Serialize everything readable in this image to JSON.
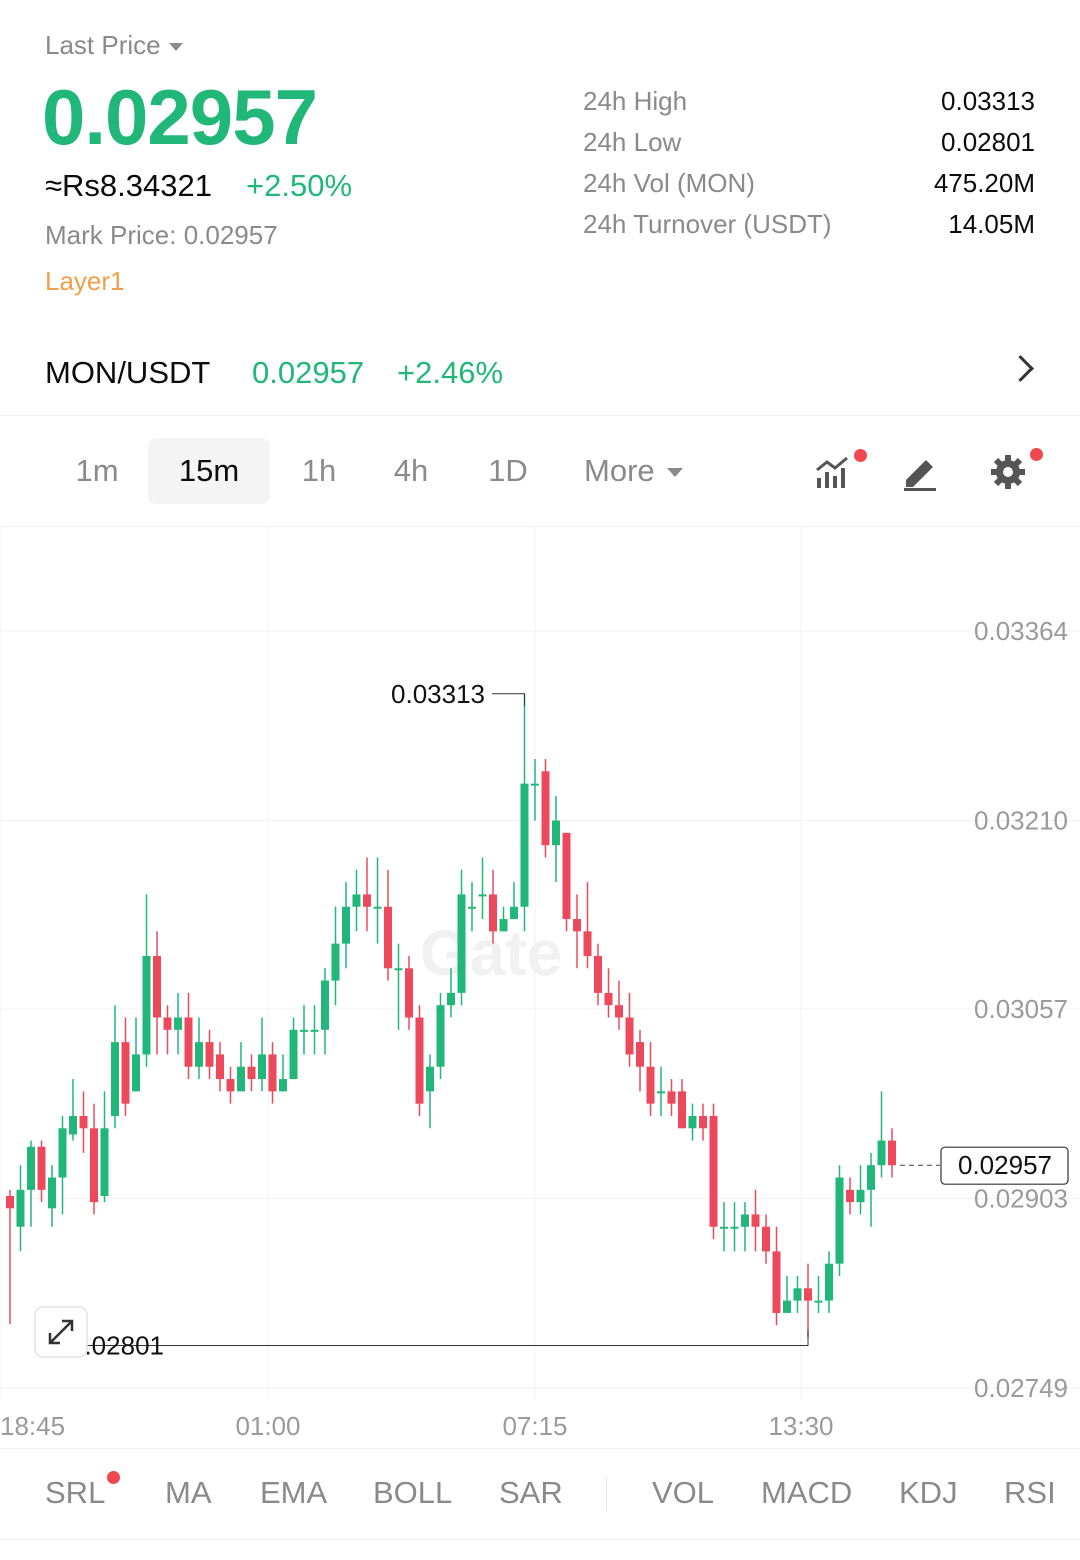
{
  "header": {
    "last_price_label": "Last Price",
    "last_price": "0.02957",
    "fiat_price": "≈Rs8.34321",
    "change_pct": "+2.50%",
    "mark_price_label": "Mark Price:",
    "mark_price": "0.02957",
    "tag": "Layer1"
  },
  "stats": [
    {
      "label": "24h High",
      "value": "0.03313"
    },
    {
      "label": "24h Low",
      "value": "0.02801"
    },
    {
      "label": "24h Vol (MON)",
      "value": "475.20M"
    },
    {
      "label": "24h Turnover (USDT)",
      "value": "14.05M"
    }
  ],
  "pair": {
    "name": "MON/USDT",
    "price": "0.02957",
    "change": "+2.46%"
  },
  "intervals": {
    "items": [
      "1m",
      "15m",
      "1h",
      "4h",
      "1D"
    ],
    "active": "15m",
    "more_label": "More"
  },
  "tools": [
    "indicator-chart-icon",
    "pencil-icon",
    "gear-icon"
  ],
  "colors": {
    "up": "#21b77a",
    "down": "#ec4a5c",
    "tag": "#f0a04b",
    "notification_dot": "#f0484e"
  },
  "chart_data": {
    "type": "candlestick",
    "interval": "15m",
    "y_ticks": [
      "0.03364",
      "0.03210",
      "0.03057",
      "0.02903",
      "0.02749"
    ],
    "x_ticks": [
      "18:45",
      "01:00",
      "07:15",
      "13:30"
    ],
    "high_label": "0.03313",
    "low_label": "0.02801",
    "last_price_label": "0.02957",
    "ylim": [
      0.02749,
      0.03364
    ],
    "watermark": "Gate",
    "candles": [
      [
        0.02905,
        0.02895,
        0.0291,
        0.02801
      ],
      [
        0.0288,
        0.0291,
        0.0293,
        0.0286
      ],
      [
        0.0291,
        0.02945,
        0.0295,
        0.0288
      ],
      [
        0.02945,
        0.0291,
        0.0295,
        0.029
      ],
      [
        0.02895,
        0.0292,
        0.0293,
        0.0288
      ],
      [
        0.0292,
        0.0296,
        0.0297,
        0.0289
      ],
      [
        0.02955,
        0.0297,
        0.03,
        0.0295
      ],
      [
        0.0297,
        0.0296,
        0.0299,
        0.0294
      ],
      [
        0.0296,
        0.029,
        0.0298,
        0.0289
      ],
      [
        0.02905,
        0.0296,
        0.0299,
        0.029
      ],
      [
        0.0297,
        0.0303,
        0.0306,
        0.0296
      ],
      [
        0.0303,
        0.0298,
        0.0305,
        0.0297
      ],
      [
        0.0299,
        0.0302,
        0.0305,
        0.0299
      ],
      [
        0.0302,
        0.031,
        0.0315,
        0.0301
      ],
      [
        0.031,
        0.0305,
        0.0312,
        0.0302
      ],
      [
        0.0305,
        0.0304,
        0.0306,
        0.0302
      ],
      [
        0.0304,
        0.0305,
        0.0307,
        0.0302
      ],
      [
        0.0305,
        0.0301,
        0.0307,
        0.03
      ],
      [
        0.0301,
        0.0303,
        0.0305,
        0.03
      ],
      [
        0.0303,
        0.0301,
        0.0304,
        0.03
      ],
      [
        0.0302,
        0.03,
        0.0303,
        0.0299
      ],
      [
        0.03,
        0.0299,
        0.0301,
        0.0298
      ],
      [
        0.0299,
        0.0301,
        0.0303,
        0.0299
      ],
      [
        0.0301,
        0.03,
        0.0302,
        0.0299
      ],
      [
        0.03,
        0.0302,
        0.0305,
        0.0299
      ],
      [
        0.0302,
        0.0299,
        0.0303,
        0.0298
      ],
      [
        0.0299,
        0.03,
        0.0302,
        0.0299
      ],
      [
        0.03,
        0.0304,
        0.0305,
        0.03
      ],
      [
        0.0304,
        0.0304,
        0.0306,
        0.0302
      ],
      [
        0.0304,
        0.0304,
        0.0306,
        0.0302
      ],
      [
        0.0304,
        0.0308,
        0.0309,
        0.0302
      ],
      [
        0.0308,
        0.0311,
        0.0314,
        0.0306
      ],
      [
        0.0311,
        0.0314,
        0.0316,
        0.0309
      ],
      [
        0.0314,
        0.0315,
        0.0317,
        0.0312
      ],
      [
        0.0315,
        0.0314,
        0.0318,
        0.0312
      ],
      [
        0.0314,
        0.0314,
        0.0318,
        0.0311
      ],
      [
        0.0314,
        0.0309,
        0.0317,
        0.0308
      ],
      [
        0.0309,
        0.0309,
        0.0311,
        0.0304
      ],
      [
        0.0309,
        0.0305,
        0.031,
        0.0304
      ],
      [
        0.0305,
        0.0298,
        0.0306,
        0.0297
      ],
      [
        0.0299,
        0.0301,
        0.0302,
        0.0296
      ],
      [
        0.0301,
        0.0306,
        0.0307,
        0.03
      ],
      [
        0.0306,
        0.0307,
        0.0309,
        0.0305
      ],
      [
        0.0307,
        0.0315,
        0.0317,
        0.0306
      ],
      [
        0.0314,
        0.0314,
        0.0316,
        0.0312
      ],
      [
        0.0315,
        0.0315,
        0.0318,
        0.0313
      ],
      [
        0.0315,
        0.0312,
        0.0317,
        0.0311
      ],
      [
        0.0312,
        0.0313,
        0.0314,
        0.0312
      ],
      [
        0.0313,
        0.0314,
        0.0316,
        0.0313
      ],
      [
        0.0314,
        0.0324,
        0.03313,
        0.0312
      ],
      [
        0.0324,
        0.0324,
        0.0326,
        0.0321
      ],
      [
        0.0325,
        0.0319,
        0.0326,
        0.0318
      ],
      [
        0.0319,
        0.0321,
        0.0323,
        0.0316
      ],
      [
        0.032,
        0.0313,
        0.032,
        0.0312
      ],
      [
        0.0313,
        0.0312,
        0.0315,
        0.0309
      ],
      [
        0.0312,
        0.031,
        0.0316,
        0.0309
      ],
      [
        0.031,
        0.0307,
        0.0311,
        0.0306
      ],
      [
        0.0307,
        0.0306,
        0.0309,
        0.0305
      ],
      [
        0.0306,
        0.0305,
        0.0308,
        0.0304
      ],
      [
        0.0305,
        0.0302,
        0.0307,
        0.0301
      ],
      [
        0.0303,
        0.0301,
        0.0304,
        0.0299
      ],
      [
        0.0301,
        0.0298,
        0.0303,
        0.0297
      ],
      [
        0.0299,
        0.0299,
        0.0301,
        0.0297
      ],
      [
        0.0299,
        0.0298,
        0.03,
        0.0297
      ],
      [
        0.0299,
        0.0296,
        0.03,
        0.0296
      ],
      [
        0.0296,
        0.0297,
        0.0298,
        0.0295
      ],
      [
        0.0297,
        0.0296,
        0.0298,
        0.0295
      ],
      [
        0.0297,
        0.0288,
        0.0298,
        0.0287
      ],
      [
        0.0288,
        0.0288,
        0.029,
        0.0286
      ],
      [
        0.0288,
        0.0288,
        0.029,
        0.0286
      ],
      [
        0.0288,
        0.0289,
        0.029,
        0.0286
      ],
      [
        0.0289,
        0.0288,
        0.0291,
        0.0286
      ],
      [
        0.0288,
        0.0286,
        0.0289,
        0.0285
      ],
      [
        0.0286,
        0.0281,
        0.0288,
        0.028
      ],
      [
        0.0281,
        0.0282,
        0.0284,
        0.0281
      ],
      [
        0.0282,
        0.0283,
        0.0284,
        0.0281
      ],
      [
        0.0283,
        0.0282,
        0.0285,
        0.0279
      ],
      [
        0.0282,
        0.0282,
        0.0284,
        0.0281
      ],
      [
        0.0282,
        0.0285,
        0.0286,
        0.0281
      ],
      [
        0.0285,
        0.0292,
        0.0293,
        0.0284
      ],
      [
        0.0291,
        0.029,
        0.0292,
        0.0289
      ],
      [
        0.029,
        0.0291,
        0.0293,
        0.0289
      ],
      [
        0.0291,
        0.0293,
        0.0294,
        0.0288
      ],
      [
        0.0293,
        0.0295,
        0.0299,
        0.0292
      ],
      [
        0.0295,
        0.0293,
        0.0296,
        0.0292
      ]
    ]
  },
  "indicators": {
    "main": [
      "SRL",
      "MA",
      "EMA",
      "BOLL",
      "SAR"
    ],
    "sub": [
      "VOL",
      "MACD",
      "KDJ",
      "RSI"
    ]
  }
}
